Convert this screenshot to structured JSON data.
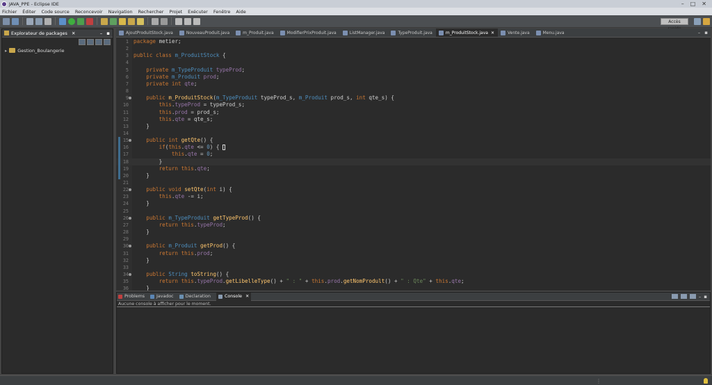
{
  "window": {
    "title": "JAVA_PPE - Eclipse IDE"
  },
  "menu": [
    "Fichier",
    "Éditer",
    "Code source",
    "Reconcevoir",
    "Navigation",
    "Rechercher",
    "Projet",
    "Exécuter",
    "Fenêtre",
    "Aide"
  ],
  "toolbar": {
    "quick_access": "Accès rapide"
  },
  "explorer": {
    "title": "Explorateur de packages",
    "project": "Gestion_Boulangerie"
  },
  "tabs": [
    {
      "label": "AjoutProduitStock.java",
      "active": false
    },
    {
      "label": "NouveauProduit.java",
      "active": false
    },
    {
      "label": "m_Produit.java",
      "active": false
    },
    {
      "label": "ModifierPrixProduit.java",
      "active": false
    },
    {
      "label": "ListManager.java",
      "active": false
    },
    {
      "label": "TypeProduit.java",
      "active": false
    },
    {
      "label": "m_ProduitStock.java",
      "active": true
    },
    {
      "label": "Vente.java",
      "active": false
    },
    {
      "label": "Menu.java",
      "active": false
    }
  ],
  "code": [
    "package metier;",
    "",
    "public class m_ProduitStock {",
    "",
    "    private m_TypeProduit typeProd;",
    "    private m_Produit prod;",
    "    private int qte;",
    "",
    "    public m_ProduitStock(m_TypeProduit typeProd_s, m_Produit prod_s, int qte_s) {",
    "        this.typeProd = typeProd_s;",
    "        this.prod = prod_s;",
    "        this.qte = qte_s;",
    "    }",
    "",
    "    public int getQte() {",
    "        if(this.qte <= 0) {",
    "            this.qte = 0;",
    "        }",
    "        return this.qte;",
    "    }",
    "",
    "    public void setQte(int i) {",
    "        this.qte -= i;",
    "    }",
    "",
    "    public m_TypeProduit getTypeProd() {",
    "        return this.typeProd;",
    "    }",
    "",
    "    public m_Produit getProd() {",
    "        return this.prod;",
    "    }",
    "",
    "    public String toString() {",
    "        return this.typeProd.getLibelleType() + \" : \" + this.prod.getNomProdult() + \" : Qte\" + this.qte;",
    "    }"
  ],
  "console": {
    "tabs": [
      "Problems",
      "Javadoc",
      "Declaration",
      "Console"
    ],
    "active": "Console",
    "message": "Aucune console à afficher pour le moment."
  }
}
